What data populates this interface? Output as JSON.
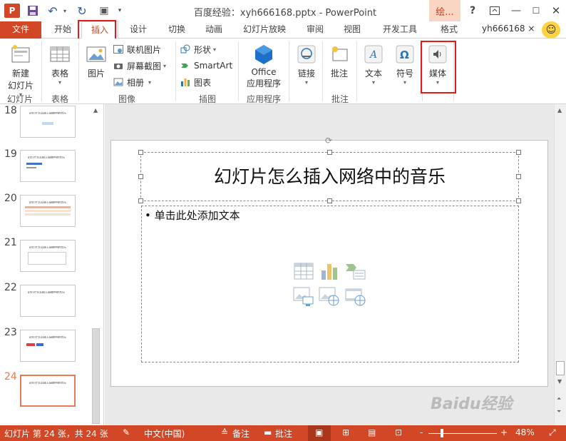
{
  "titlebar": {
    "app_logo": "P",
    "window_title": "百度经验：xyh666168.pptx - PowerPoint",
    "contextual_tab": "绘...",
    "help": "?",
    "icons": [
      "save-icon",
      "undo-icon",
      "redo-icon",
      "present-icon",
      "minimize-icon",
      "maximize-icon",
      "close-icon"
    ]
  },
  "tabs": {
    "file": "文件",
    "home": "开始",
    "insert": "插入",
    "design": "设计",
    "transitions": "切换",
    "animations": "动画",
    "slideshow": "幻灯片放映",
    "review": "审阅",
    "view": "视图",
    "developer": "开发工具",
    "format": "格式",
    "user": "yh666168 ×"
  },
  "ribbon": {
    "new_slide_line1": "新建",
    "new_slide_line2": "幻灯片",
    "table": "表格",
    "picture": "图片",
    "online_pictures": "联机图片",
    "screenshot": "屏幕截图",
    "album": "相册",
    "shapes": "形状",
    "smartart": "SmartArt",
    "chart": "图表",
    "office_line1": "Office",
    "office_line2": "应用程序",
    "link": "链接",
    "comment": "批注",
    "text": "文本",
    "symbol": "符号",
    "media": "媒体",
    "groups": {
      "slides": "幻灯片",
      "tables": "表格",
      "images": "图像",
      "illustrations": "插图",
      "apps": "应用程序",
      "comments": "批注"
    }
  },
  "thumbnails": [
    {
      "num": "18",
      "text": "幻灯片怎么插入网络中的音乐"
    },
    {
      "num": "19",
      "text": "幻灯片怎么插入网络中的音乐"
    },
    {
      "num": "20",
      "text": "幻灯片怎么插入网络中的音乐"
    },
    {
      "num": "21",
      "text": "幻灯片怎么插入网络中的音乐"
    },
    {
      "num": "22",
      "text": "幻灯片怎么插入网络中的音乐"
    },
    {
      "num": "23",
      "text": "幻灯片怎么插入网络中的音乐"
    },
    {
      "num": "24",
      "text": "幻灯片怎么插入网络中的音乐"
    }
  ],
  "slide": {
    "title": "幻灯片怎么插入网络中的音乐",
    "content": "• 单击此处添加文本"
  },
  "watermark": "Baidu经验",
  "statusbar": {
    "slide_info": "幻灯片 第 24 张，共 24 张",
    "language": "中文(中国)",
    "notes": "备注",
    "comments": "批注",
    "zoom": "48%",
    "zoom_minus": "-",
    "zoom_plus": "+"
  },
  "colors": {
    "accent": "#d24726",
    "highlight_frame": "#e31b1b"
  }
}
